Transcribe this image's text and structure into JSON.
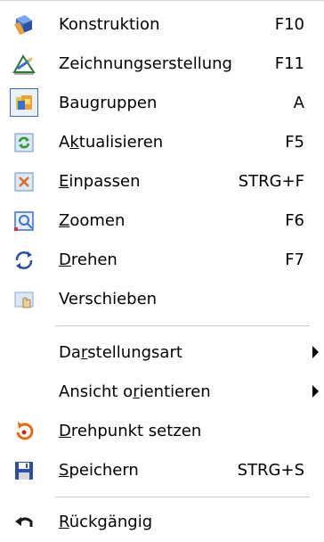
{
  "menu": {
    "items": [
      {
        "label": "Konstruktion",
        "shortcut": "F10",
        "icon": "construction-icon"
      },
      {
        "label": "Zeichnungserstellung",
        "shortcut": "F11",
        "icon": "drawing-creation-icon"
      },
      {
        "label": "Baugruppen",
        "shortcut": "A",
        "icon": "assemblies-icon",
        "checked": true
      },
      {
        "label_pre": "A",
        "label_u": "k",
        "label_post": "tualisieren",
        "shortcut": "F5",
        "icon": "refresh-icon"
      },
      {
        "label_pre": "",
        "label_u": "E",
        "label_post": "inpassen",
        "shortcut": "STRG+F",
        "icon": "fit-icon"
      },
      {
        "label_pre": "",
        "label_u": "Z",
        "label_post": "oomen",
        "shortcut": "F6",
        "icon": "zoom-icon"
      },
      {
        "label_pre": "",
        "label_u": "D",
        "label_post": "rehen",
        "shortcut": "F7",
        "icon": "rotate-icon"
      },
      {
        "label": "Verschieben",
        "shortcut": "",
        "icon": "pan-icon"
      },
      {
        "label_pre": "Da",
        "label_u": "r",
        "label_post": "stellungsart",
        "shortcut": "",
        "icon": "",
        "submenu": true
      },
      {
        "label_pre": "Ansicht o",
        "label_u": "r",
        "label_post": "ientieren",
        "shortcut": "",
        "icon": "",
        "submenu": true
      },
      {
        "label_pre": "",
        "label_u": "D",
        "label_post": "rehpunkt setzen",
        "shortcut": "",
        "icon": "pivot-icon"
      },
      {
        "label_pre": "",
        "label_u": "S",
        "label_post": "peichern",
        "shortcut": "STRG+S",
        "icon": "save-icon"
      },
      {
        "label_pre": "",
        "label_u": "R",
        "label_post": "ückgängig",
        "shortcut": "",
        "icon": "undo-icon"
      }
    ]
  },
  "colors": {
    "checked_border": "#3c6ab8",
    "checked_bg": "#e8f0fb",
    "separator": "#c8c8c8"
  }
}
